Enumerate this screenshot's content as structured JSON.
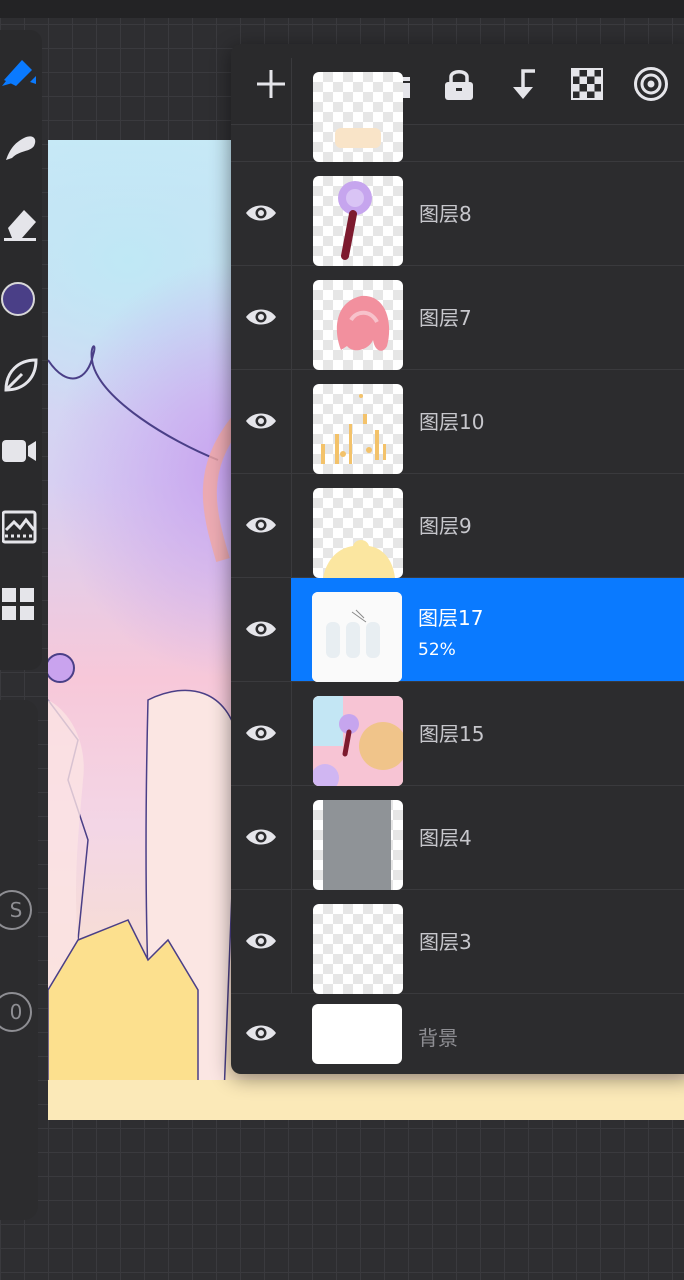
{
  "header": {
    "add_icon": "plus-icon",
    "group_icon": "folder-icon",
    "lock_icon": "lock-icon",
    "merge_icon": "merge-down-icon",
    "alpha_icon": "checkerboard-icon",
    "blend_icon": "concentric-circle-icon"
  },
  "toolbar": {
    "brush_color": "#4a3f87",
    "accent": "#0a7aff",
    "tools": [
      "pen-tool-icon",
      "smudge-icon",
      "eraser-icon",
      "color-swatch",
      "leaf-icon",
      "video-icon",
      "adjust-icon",
      "gallery-icon"
    ],
    "btn_s_label": "S",
    "btn_o_label": "0"
  },
  "layers": [
    {
      "name": "",
      "visible": true,
      "selected": false
    },
    {
      "name": "图层8",
      "visible": true,
      "selected": false
    },
    {
      "name": "图层7",
      "visible": true,
      "selected": false
    },
    {
      "name": "图层10",
      "visible": true,
      "selected": false
    },
    {
      "name": "图层9",
      "visible": true,
      "selected": false
    },
    {
      "name": "图层17",
      "opacity": "52%",
      "visible": true,
      "selected": true
    },
    {
      "name": "图层15",
      "visible": true,
      "selected": false
    },
    {
      "name": "图层4",
      "visible": true,
      "selected": false
    },
    {
      "name": "图层3",
      "visible": true,
      "selected": false
    },
    {
      "name": "背景",
      "visible": true,
      "selected": false
    }
  ]
}
